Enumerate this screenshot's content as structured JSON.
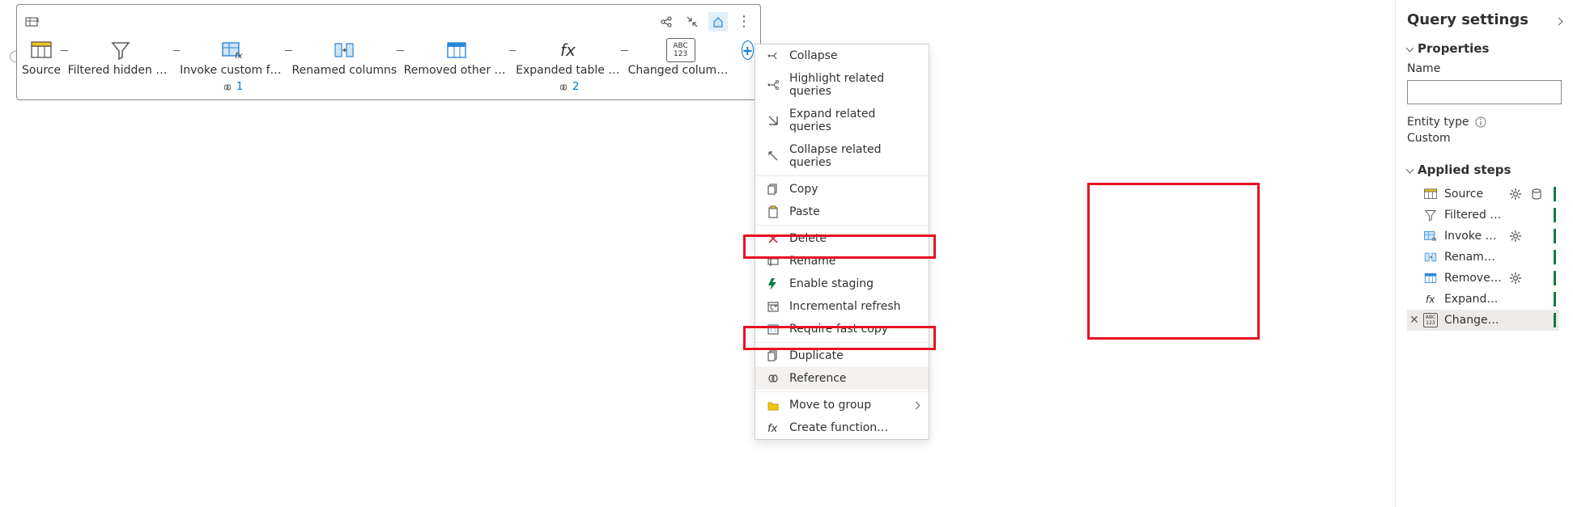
{
  "diagram": {
    "steps": [
      {
        "label": "Source",
        "icon": "table-orange",
        "ref": null
      },
      {
        "label": "Filtered hidden fi…",
        "icon": "funnel",
        "ref": null
      },
      {
        "label": "Invoke custom fu…",
        "icon": "table-fx",
        "ref": "1"
      },
      {
        "label": "Renamed columns",
        "icon": "rename-cols",
        "ref": null
      },
      {
        "label": "Removed other c…",
        "icon": "table-blue",
        "ref": null
      },
      {
        "label": "Expanded table c…",
        "icon": "fx",
        "ref": "2"
      },
      {
        "label": "Changed column…",
        "icon": "abc123",
        "ref": null
      }
    ]
  },
  "context_menu": [
    {
      "label": "Collapse",
      "icon": "collapse"
    },
    {
      "label": "Highlight related queries",
      "icon": "highlight-related"
    },
    {
      "label": "Expand related queries",
      "icon": "expand-related"
    },
    {
      "label": "Collapse related queries",
      "icon": "collapse-related"
    },
    {
      "sep": true
    },
    {
      "label": "Copy",
      "icon": "copy"
    },
    {
      "label": "Paste",
      "icon": "paste"
    },
    {
      "sep": true
    },
    {
      "label": "Delete",
      "icon": "delete"
    },
    {
      "label": "Rename",
      "icon": "rename"
    },
    {
      "label": "Enable staging",
      "icon": "staging"
    },
    {
      "label": "Incremental refresh",
      "icon": "incremental"
    },
    {
      "label": "Require fast copy",
      "icon": "fastcopy"
    },
    {
      "sep": true
    },
    {
      "label": "Duplicate",
      "icon": "duplicate"
    },
    {
      "label": "Reference",
      "icon": "reference",
      "selected": true
    },
    {
      "sep": true
    },
    {
      "label": "Move to group",
      "icon": "folder",
      "submenu": true
    },
    {
      "label": "Create function…",
      "icon": "fx-sm"
    }
  ],
  "settings": {
    "panel_title": "Query settings",
    "properties": {
      "section": "Properties",
      "name_label": "Name",
      "name_value": "",
      "entity_label": "Entity type",
      "entity_value": "Custom"
    },
    "applied_steps": {
      "section": "Applied steps",
      "items": [
        {
          "label": "Source",
          "icon": "table-orange",
          "gear": true,
          "extra": "db"
        },
        {
          "label": "Filtered hid…",
          "icon": "funnel"
        },
        {
          "label": "Invoke cust…",
          "icon": "table-fx",
          "gear": true
        },
        {
          "label": "Renamed c…",
          "icon": "rename-cols"
        },
        {
          "label": "Removed o…",
          "icon": "table-blue",
          "gear": true
        },
        {
          "label": "Expanded t…",
          "icon": "fx"
        },
        {
          "label": "Changed c…",
          "icon": "abc123",
          "selected": true,
          "removable": true
        }
      ]
    }
  }
}
